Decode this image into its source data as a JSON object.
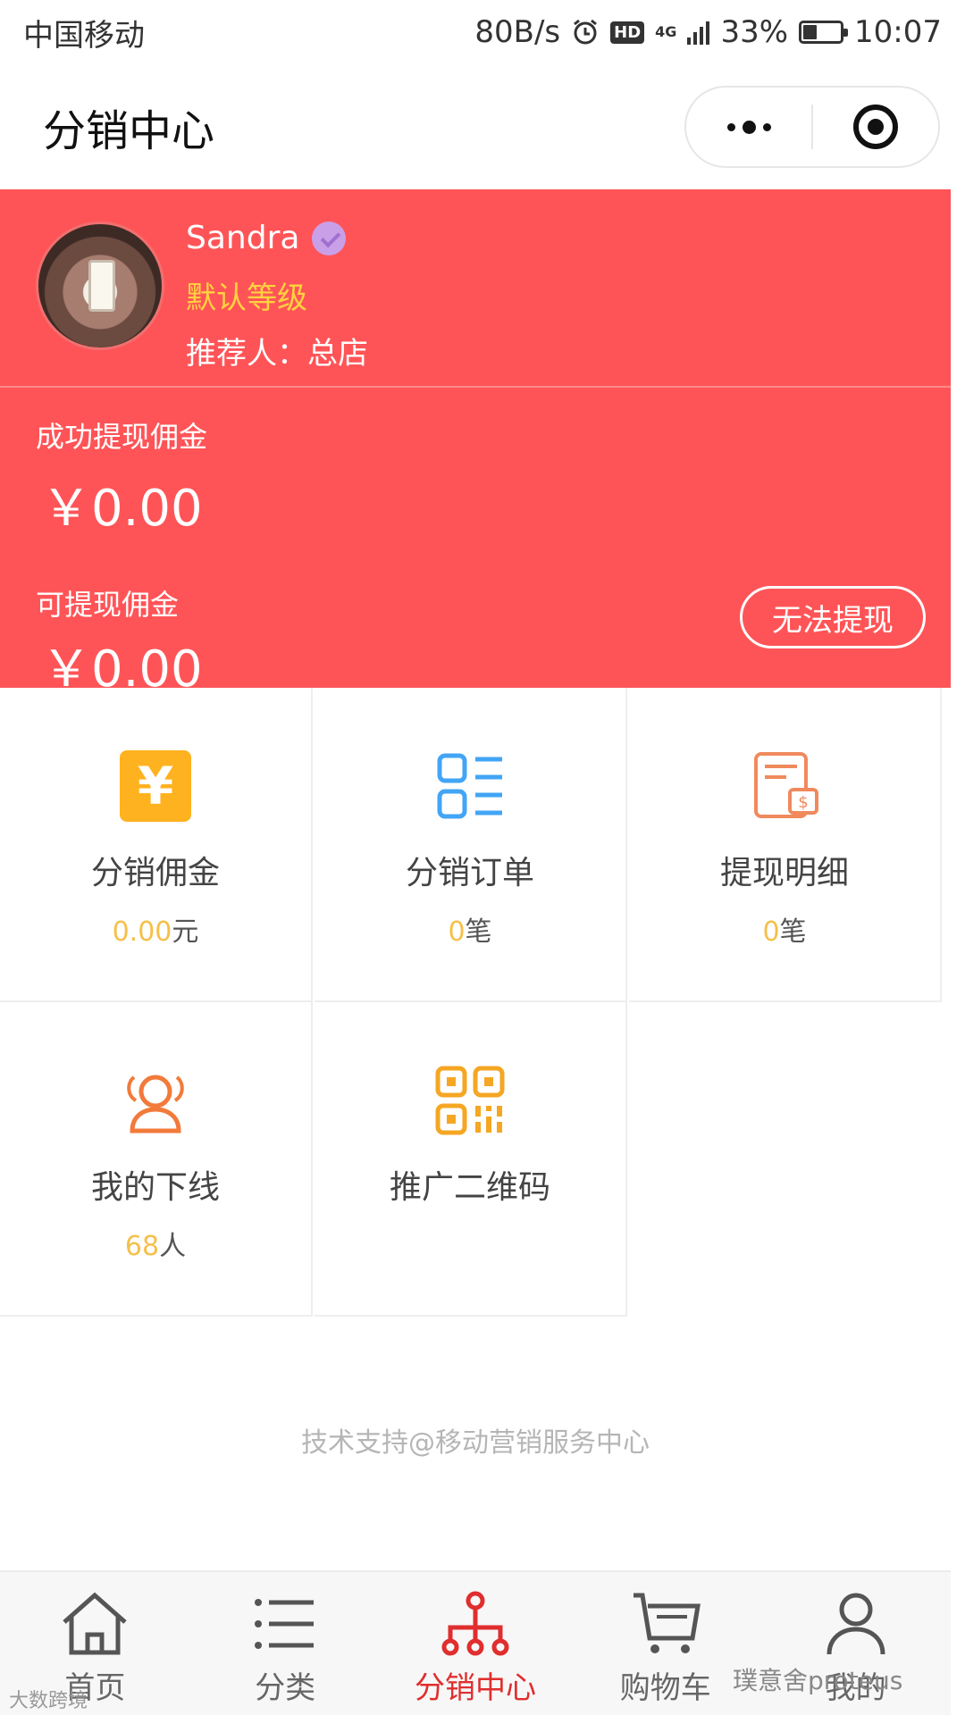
{
  "status_bar": {
    "carrier": "中国移动",
    "net_speed": "80B/s",
    "battery": "33%",
    "battery_level": 0.33,
    "time": "10:07",
    "hd": "HD",
    "network": "4G"
  },
  "header": {
    "title": "分销中心"
  },
  "profile": {
    "name": "Sandra",
    "level": "默认等级",
    "referrer": "推荐人：总店"
  },
  "earnings": {
    "success_label": "成功提现佣金",
    "success_value": "￥0.00",
    "available_label": "可提现佣金",
    "available_value": "￥0.00",
    "withdraw_button": "无法提现"
  },
  "grid": [
    {
      "label": "分销佣金",
      "num": "0.00",
      "unit": "元",
      "icon": "yen-icon"
    },
    {
      "label": "分销订单",
      "num": "0",
      "unit": "笔",
      "icon": "order-list-icon"
    },
    {
      "label": "提现明细",
      "num": "0",
      "unit": "笔",
      "icon": "receipt-icon"
    },
    {
      "label": "我的下线",
      "num": "68",
      "unit": "人",
      "icon": "team-icon"
    },
    {
      "label": "推广二维码",
      "num": "",
      "unit": "",
      "icon": "qr-code-icon"
    }
  ],
  "footer_note": "技术支持@移动营销服务中心",
  "tabbar": [
    {
      "label": "首页",
      "icon": "home-icon",
      "active": false
    },
    {
      "label": "分类",
      "icon": "category-icon",
      "active": false
    },
    {
      "label": "分销中心",
      "icon": "distribution-icon",
      "active": true
    },
    {
      "label": "购物车",
      "icon": "cart-icon",
      "active": false
    },
    {
      "label": "我的",
      "icon": "user-icon",
      "active": false
    }
  ],
  "watermarks": {
    "right": "璞意舍proteus",
    "left": "大数跨境"
  },
  "colors": {
    "brand_red": "#ff5457",
    "accent_yellow": "#ffd23f",
    "number_yellow": "#f5c04a",
    "tab_active": "#e02e2e"
  }
}
